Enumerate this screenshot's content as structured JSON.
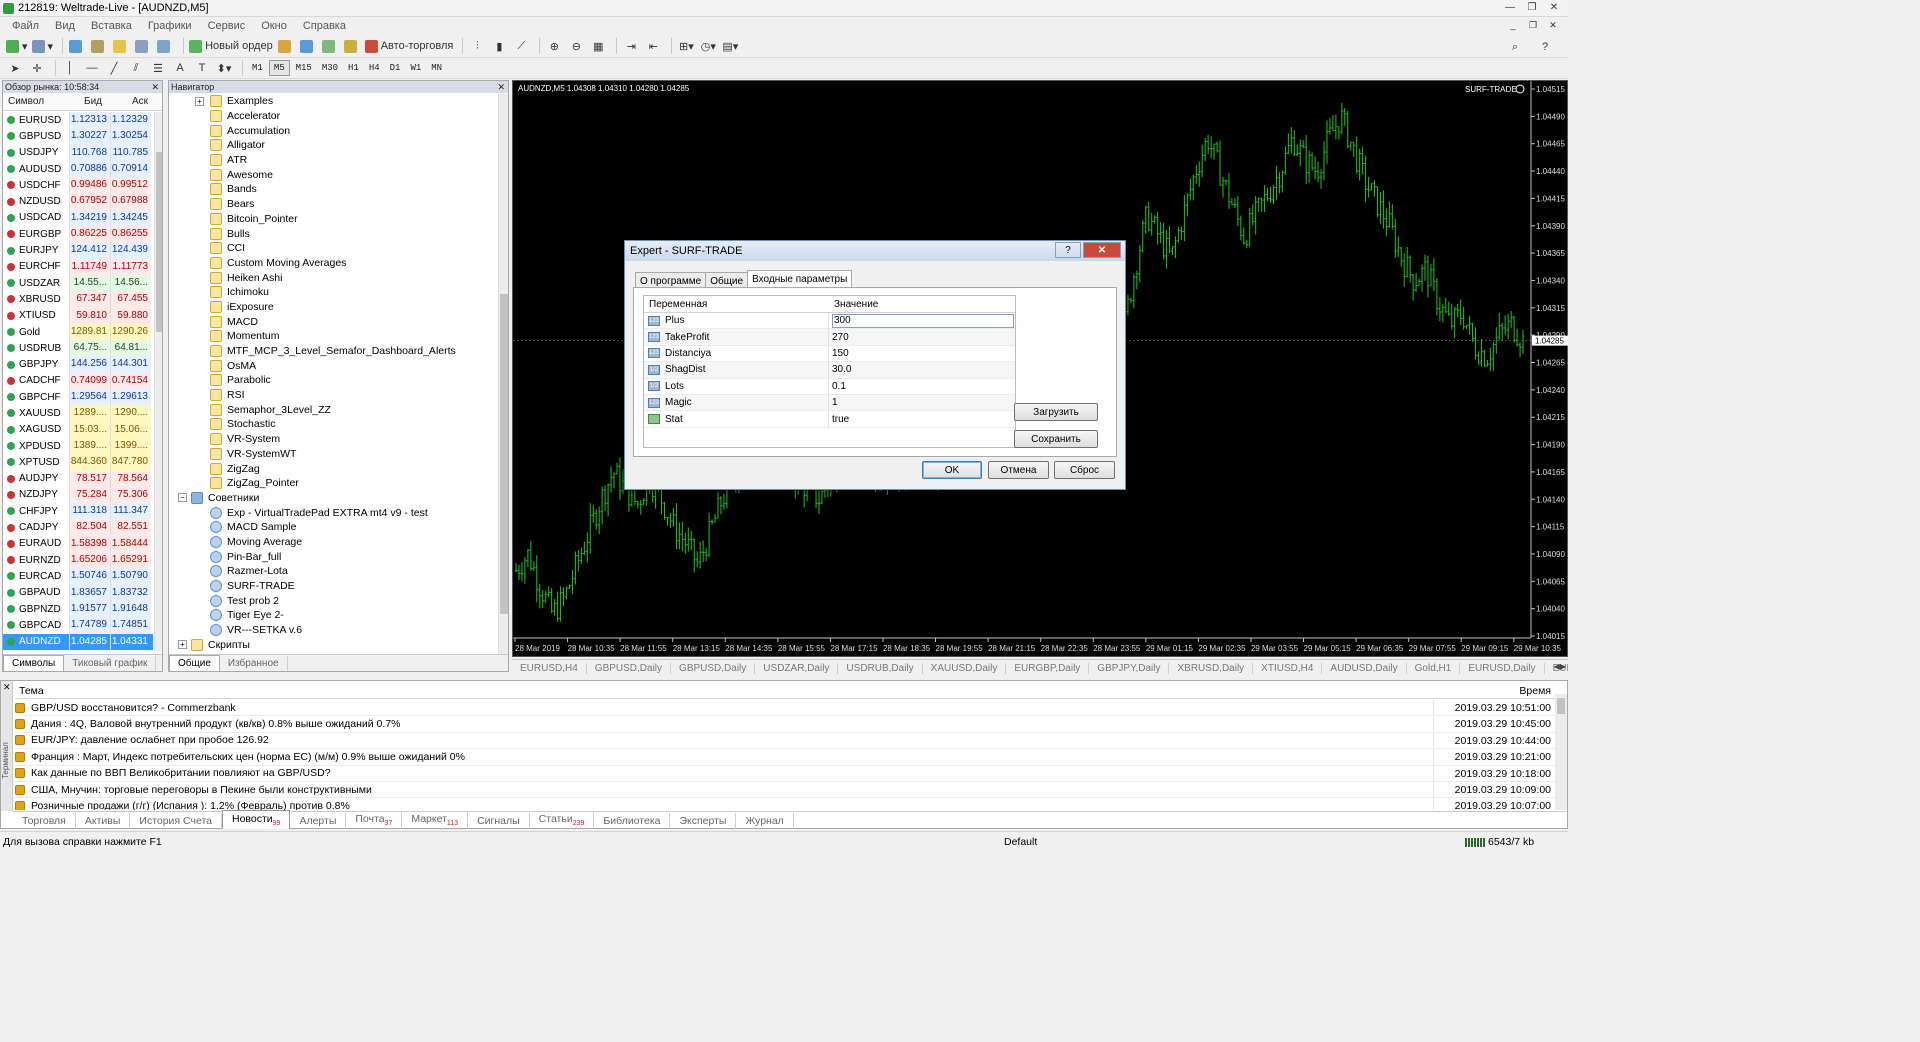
{
  "window": {
    "title": "212819: Weltrade-Live - [AUDNZD,M5]"
  },
  "menu": [
    "Файл",
    "Вид",
    "Вставка",
    "Графики",
    "Сервис",
    "Окно",
    "Справка"
  ],
  "toolbar": {
    "new_order": "Новый ордер",
    "autotrading": "Авто-торговля"
  },
  "timeframes": [
    "M1",
    "M5",
    "M15",
    "M30",
    "H1",
    "H4",
    "D1",
    "W1",
    "MN"
  ],
  "active_timeframe": "M5",
  "market_watch": {
    "title": "Обзор рынка: 10:58:34",
    "headers": {
      "symbol": "Символ",
      "bid": "Бид",
      "ask": "Аск"
    },
    "rows": [
      {
        "s": "EURUSD",
        "b": "1.12313",
        "a": "1.12329",
        "c": "blue"
      },
      {
        "s": "GBPUSD",
        "b": "1.30227",
        "a": "1.30254",
        "c": "blue"
      },
      {
        "s": "USDJPY",
        "b": "110.768",
        "a": "110.785",
        "c": "blue"
      },
      {
        "s": "AUDUSD",
        "b": "0.70886",
        "a": "0.70914",
        "c": "blue"
      },
      {
        "s": "USDCHF",
        "b": "0.99486",
        "a": "0.99512",
        "c": "red"
      },
      {
        "s": "NZDUSD",
        "b": "0.67952",
        "a": "0.67988",
        "c": "red"
      },
      {
        "s": "USDCAD",
        "b": "1.34219",
        "a": "1.34245",
        "c": "blue"
      },
      {
        "s": "EURGBP",
        "b": "0.86225",
        "a": "0.86255",
        "c": "red"
      },
      {
        "s": "EURJPY",
        "b": "124.412",
        "a": "124.439",
        "c": "blue"
      },
      {
        "s": "EURCHF",
        "b": "1.11749",
        "a": "1.11773",
        "c": "red"
      },
      {
        "s": "USDZAR",
        "b": "14.55...",
        "a": "14.56...",
        "c": "green"
      },
      {
        "s": "XBRUSD",
        "b": "67.347",
        "a": "67.455",
        "c": "red"
      },
      {
        "s": "XTIUSD",
        "b": "59.810",
        "a": "59.880",
        "c": "red"
      },
      {
        "s": "Gold",
        "b": "1289.81",
        "a": "1290.26",
        "c": "yellow"
      },
      {
        "s": "USDRUB",
        "b": "64.75...",
        "a": "64.81...",
        "c": "green"
      },
      {
        "s": "GBPJPY",
        "b": "144.256",
        "a": "144.301",
        "c": "blue"
      },
      {
        "s": "CADCHF",
        "b": "0.74099",
        "a": "0.74154",
        "c": "red"
      },
      {
        "s": "GBPCHF",
        "b": "1.29564",
        "a": "1.29613",
        "c": "blue"
      },
      {
        "s": "XAUUSD",
        "b": "1289....",
        "a": "1290....",
        "c": "yellow"
      },
      {
        "s": "XAGUSD",
        "b": "15.03...",
        "a": "15.06...",
        "c": "yellow"
      },
      {
        "s": "XPDUSD",
        "b": "1389....",
        "a": "1399....",
        "c": "yellow"
      },
      {
        "s": "XPTUSD",
        "b": "844.360",
        "a": "847.780",
        "c": "yellow"
      },
      {
        "s": "AUDJPY",
        "b": "78.517",
        "a": "78.564",
        "c": "red"
      },
      {
        "s": "NZDJPY",
        "b": "75.284",
        "a": "75.306",
        "c": "red"
      },
      {
        "s": "CHFJPY",
        "b": "111.318",
        "a": "111.347",
        "c": "blue"
      },
      {
        "s": "CADJPY",
        "b": "82.504",
        "a": "82.551",
        "c": "red"
      },
      {
        "s": "EURAUD",
        "b": "1.58398",
        "a": "1.58444",
        "c": "red"
      },
      {
        "s": "EURNZD",
        "b": "1.65206",
        "a": "1.65291",
        "c": "red"
      },
      {
        "s": "EURCAD",
        "b": "1.50746",
        "a": "1.50790",
        "c": "blue"
      },
      {
        "s": "GBPAUD",
        "b": "1.83657",
        "a": "1.83732",
        "c": "blue"
      },
      {
        "s": "GBPNZD",
        "b": "1.91577",
        "a": "1.91648",
        "c": "blue"
      },
      {
        "s": "GBPCAD",
        "b": "1.74789",
        "a": "1.74851",
        "c": "blue"
      },
      {
        "s": "AUDNZD",
        "b": "1.04285",
        "a": "1.04331",
        "c": "selected"
      }
    ],
    "tabs": [
      "Символы",
      "Тиковый график"
    ]
  },
  "navigator": {
    "title": "Навигатор",
    "indicators": [
      "Examples",
      "Accelerator",
      "Accumulation",
      "Alligator",
      "ATR",
      "Awesome",
      "Bands",
      "Bears",
      "Bitcoin_Pointer",
      "Bulls",
      "CCI",
      "Custom Moving Averages",
      "Heiken Ashi",
      "Ichimoku",
      "iExposure",
      "MACD",
      "Momentum",
      "MTF_MCP_3_Level_Semafor_Dashboard_Alerts",
      "OsMA",
      "Parabolic",
      "RSI",
      "Semaphor_3Level_ZZ",
      "Stochastic",
      "VR-System",
      "VR-SystemWT",
      "ZigZag",
      "ZigZag_Pointer"
    ],
    "experts_group": "Советники",
    "experts": [
      "Exp - VirtualTradePad EXTRA mt4 v9 - test",
      "MACD Sample",
      "Moving Average",
      "Pin-Bar_full",
      "Razmer-Lota",
      "SURF-TRADE",
      "Test prob 2",
      "Tiger Eye 2-",
      "VR---SETKA v.6"
    ],
    "scripts_group": "Скрипты",
    "tabs": [
      "Общие",
      "Избранное"
    ]
  },
  "chart": {
    "header": "AUDNZD,M5  1.04308 1.04310 1.04280 1.04285",
    "ea_label": "SURF-TRADE",
    "current_price": "1.04285",
    "price_ticks": [
      "1.04515",
      "1.04490",
      "1.04465",
      "1.04440",
      "1.04415",
      "1.04390",
      "1.04365",
      "1.04340",
      "1.04315",
      "1.04290",
      "1.04265",
      "1.04240",
      "1.04215",
      "1.04190",
      "1.04165",
      "1.04140",
      "1.04115",
      "1.04090",
      "1.04065",
      "1.04040",
      "1.04015"
    ],
    "time_ticks": [
      "28 Mar 2019",
      "28 Mar 10:35",
      "28 Mar 11:55",
      "28 Mar 13:15",
      "28 Mar 14:35",
      "28 Mar 15:55",
      "28 Mar 17:15",
      "28 Mar 18:35",
      "28 Mar 19:55",
      "28 Mar 21:15",
      "28 Mar 22:35",
      "28 Mar 23:55",
      "29 Mar 01:15",
      "29 Mar 02:35",
      "29 Mar 03:55",
      "29 Mar 05:15",
      "29 Mar 06:35",
      "29 Mar 07:55",
      "29 Mar 09:15",
      "29 Mar 10:35"
    ],
    "close_series": [
      1.04075,
      1.0409,
      1.0406,
      1.04035,
      1.0405,
      1.0408,
      1.0411,
      1.0414,
      1.04165,
      1.0415,
      1.04135,
      1.0416,
      1.0414,
      1.04115,
      1.041,
      1.0408,
      1.0411,
      1.0414,
      1.0416,
      1.0418,
      1.042,
      1.0419,
      1.0417,
      1.0416,
      1.0415,
      1.0414,
      1.0416,
      1.0417,
      1.0419,
      1.04175,
      1.0416,
      1.0417,
      1.0415,
      1.0416,
      1.0417,
      1.0416,
      1.0418,
      1.0419,
      1.04175,
      1.04165,
      1.0418,
      1.042,
      1.0422,
      1.042,
      1.04185,
      1.0421,
      1.0423,
      1.0422,
      1.0421,
      1.0426,
      1.0429,
      1.0435,
      1.044,
      1.0438,
      1.0436,
      1.044,
      1.0444,
      1.0447,
      1.0444,
      1.0441,
      1.0438,
      1.044,
      1.0442,
      1.0444,
      1.0447,
      1.0445,
      1.0444,
      1.0447,
      1.0449,
      1.0446,
      1.0443,
      1.0441,
      1.0439,
      1.0436,
      1.0434,
      1.0435,
      1.0432,
      1.043,
      1.0431,
      1.0428,
      1.0427,
      1.0429,
      1.043,
      1.04285
    ]
  },
  "chart_tabs": [
    "EURUSD,H4",
    "GBPUSD,Daily",
    "GBPUSD,Daily",
    "USDZAR,Daily",
    "USDRUB,Daily",
    "XAUUSD,Daily",
    "EURGBP,Daily",
    "GBPJPY,Daily",
    "XBRUSD,Daily",
    "XTIUSD,H4",
    "AUDUSD,Daily",
    "Gold,H1",
    "EURUSD,Daily",
    "EURUSD,D"
  ],
  "dialog": {
    "title": "Expert - SURF-TRADE",
    "help": "?",
    "close": "✕",
    "tabs": [
      "О программе",
      "Общие",
      "Входные параметры"
    ],
    "active_tab": "Входные параметры",
    "headers": {
      "var": "Переменная",
      "val": "Значение"
    },
    "params": [
      {
        "n": "Plus",
        "v": "300",
        "t": "123"
      },
      {
        "n": "TakeProfit",
        "v": "270",
        "t": "123"
      },
      {
        "n": "Distanciya",
        "v": "150",
        "t": "123"
      },
      {
        "n": "ShagDist",
        "v": "30.0",
        "t": "1/2"
      },
      {
        "n": "Lots",
        "v": "0.1",
        "t": "1/2"
      },
      {
        "n": "Magic",
        "v": "1",
        "t": "123"
      },
      {
        "n": "Stat",
        "v": "true",
        "t": "bool"
      }
    ],
    "load": "Загрузить",
    "save": "Сохранить",
    "ok": "OK",
    "cancel": "Отмена",
    "reset": "Сброс"
  },
  "terminal": {
    "side_label": "Терминал",
    "col_subject": "Тема",
    "col_time": "Время",
    "news": [
      {
        "t": "GBP/USD восстановится? - Commerzbank",
        "d": "2019.03.29 10:51:00"
      },
      {
        "t": "Дания : 4Q, Валовой внутренний продукт (кв/кв)  0.8% выше ожиданий 0.7%",
        "d": "2019.03.29 10:45:00"
      },
      {
        "t": "EUR/JPY: давление ослабнет при пробое 126.92",
        "d": "2019.03.29 10:44:00"
      },
      {
        "t": "Франция : Март, Индекс потребительских цен (норма ЕС) (м/м)  0.9% выше ожиданий 0%",
        "d": "2019.03.29 10:21:00"
      },
      {
        "t": "Как данные по ВВП Великобритании повлияют на GBP/USD?",
        "d": "2019.03.29 10:18:00"
      },
      {
        "t": "США, Мнучин: торговые переговоры в Пекине были конструктивными",
        "d": "2019.03.29 10:09:00"
      },
      {
        "t": "Розничные продажи (г/г) (Испания ): 1.2% (Февраль) против 0.8%",
        "d": "2019.03.29 10:07:00"
      }
    ],
    "tabs": [
      {
        "l": "Торговля",
        "c": ""
      },
      {
        "l": "Активы",
        "c": ""
      },
      {
        "l": "История Счета",
        "c": ""
      },
      {
        "l": "Новости",
        "c": "99"
      },
      {
        "l": "Алерты",
        "c": ""
      },
      {
        "l": "Почта",
        "c": "37"
      },
      {
        "l": "Маркет",
        "c": "113"
      },
      {
        "l": "Сигналы",
        "c": ""
      },
      {
        "l": "Статьи",
        "c": "239"
      },
      {
        "l": "Библиотека",
        "c": ""
      },
      {
        "l": "Эксперты",
        "c": ""
      },
      {
        "l": "Журнал",
        "c": ""
      }
    ],
    "active_tab": "Новости"
  },
  "status": {
    "help": "Для вызова справки нажмите F1",
    "profile": "Default",
    "traffic": "6543/7 kb"
  },
  "colors": {
    "chart_bg": "#000000",
    "bar_color": "#1ec41e",
    "select": "#3399ff"
  }
}
